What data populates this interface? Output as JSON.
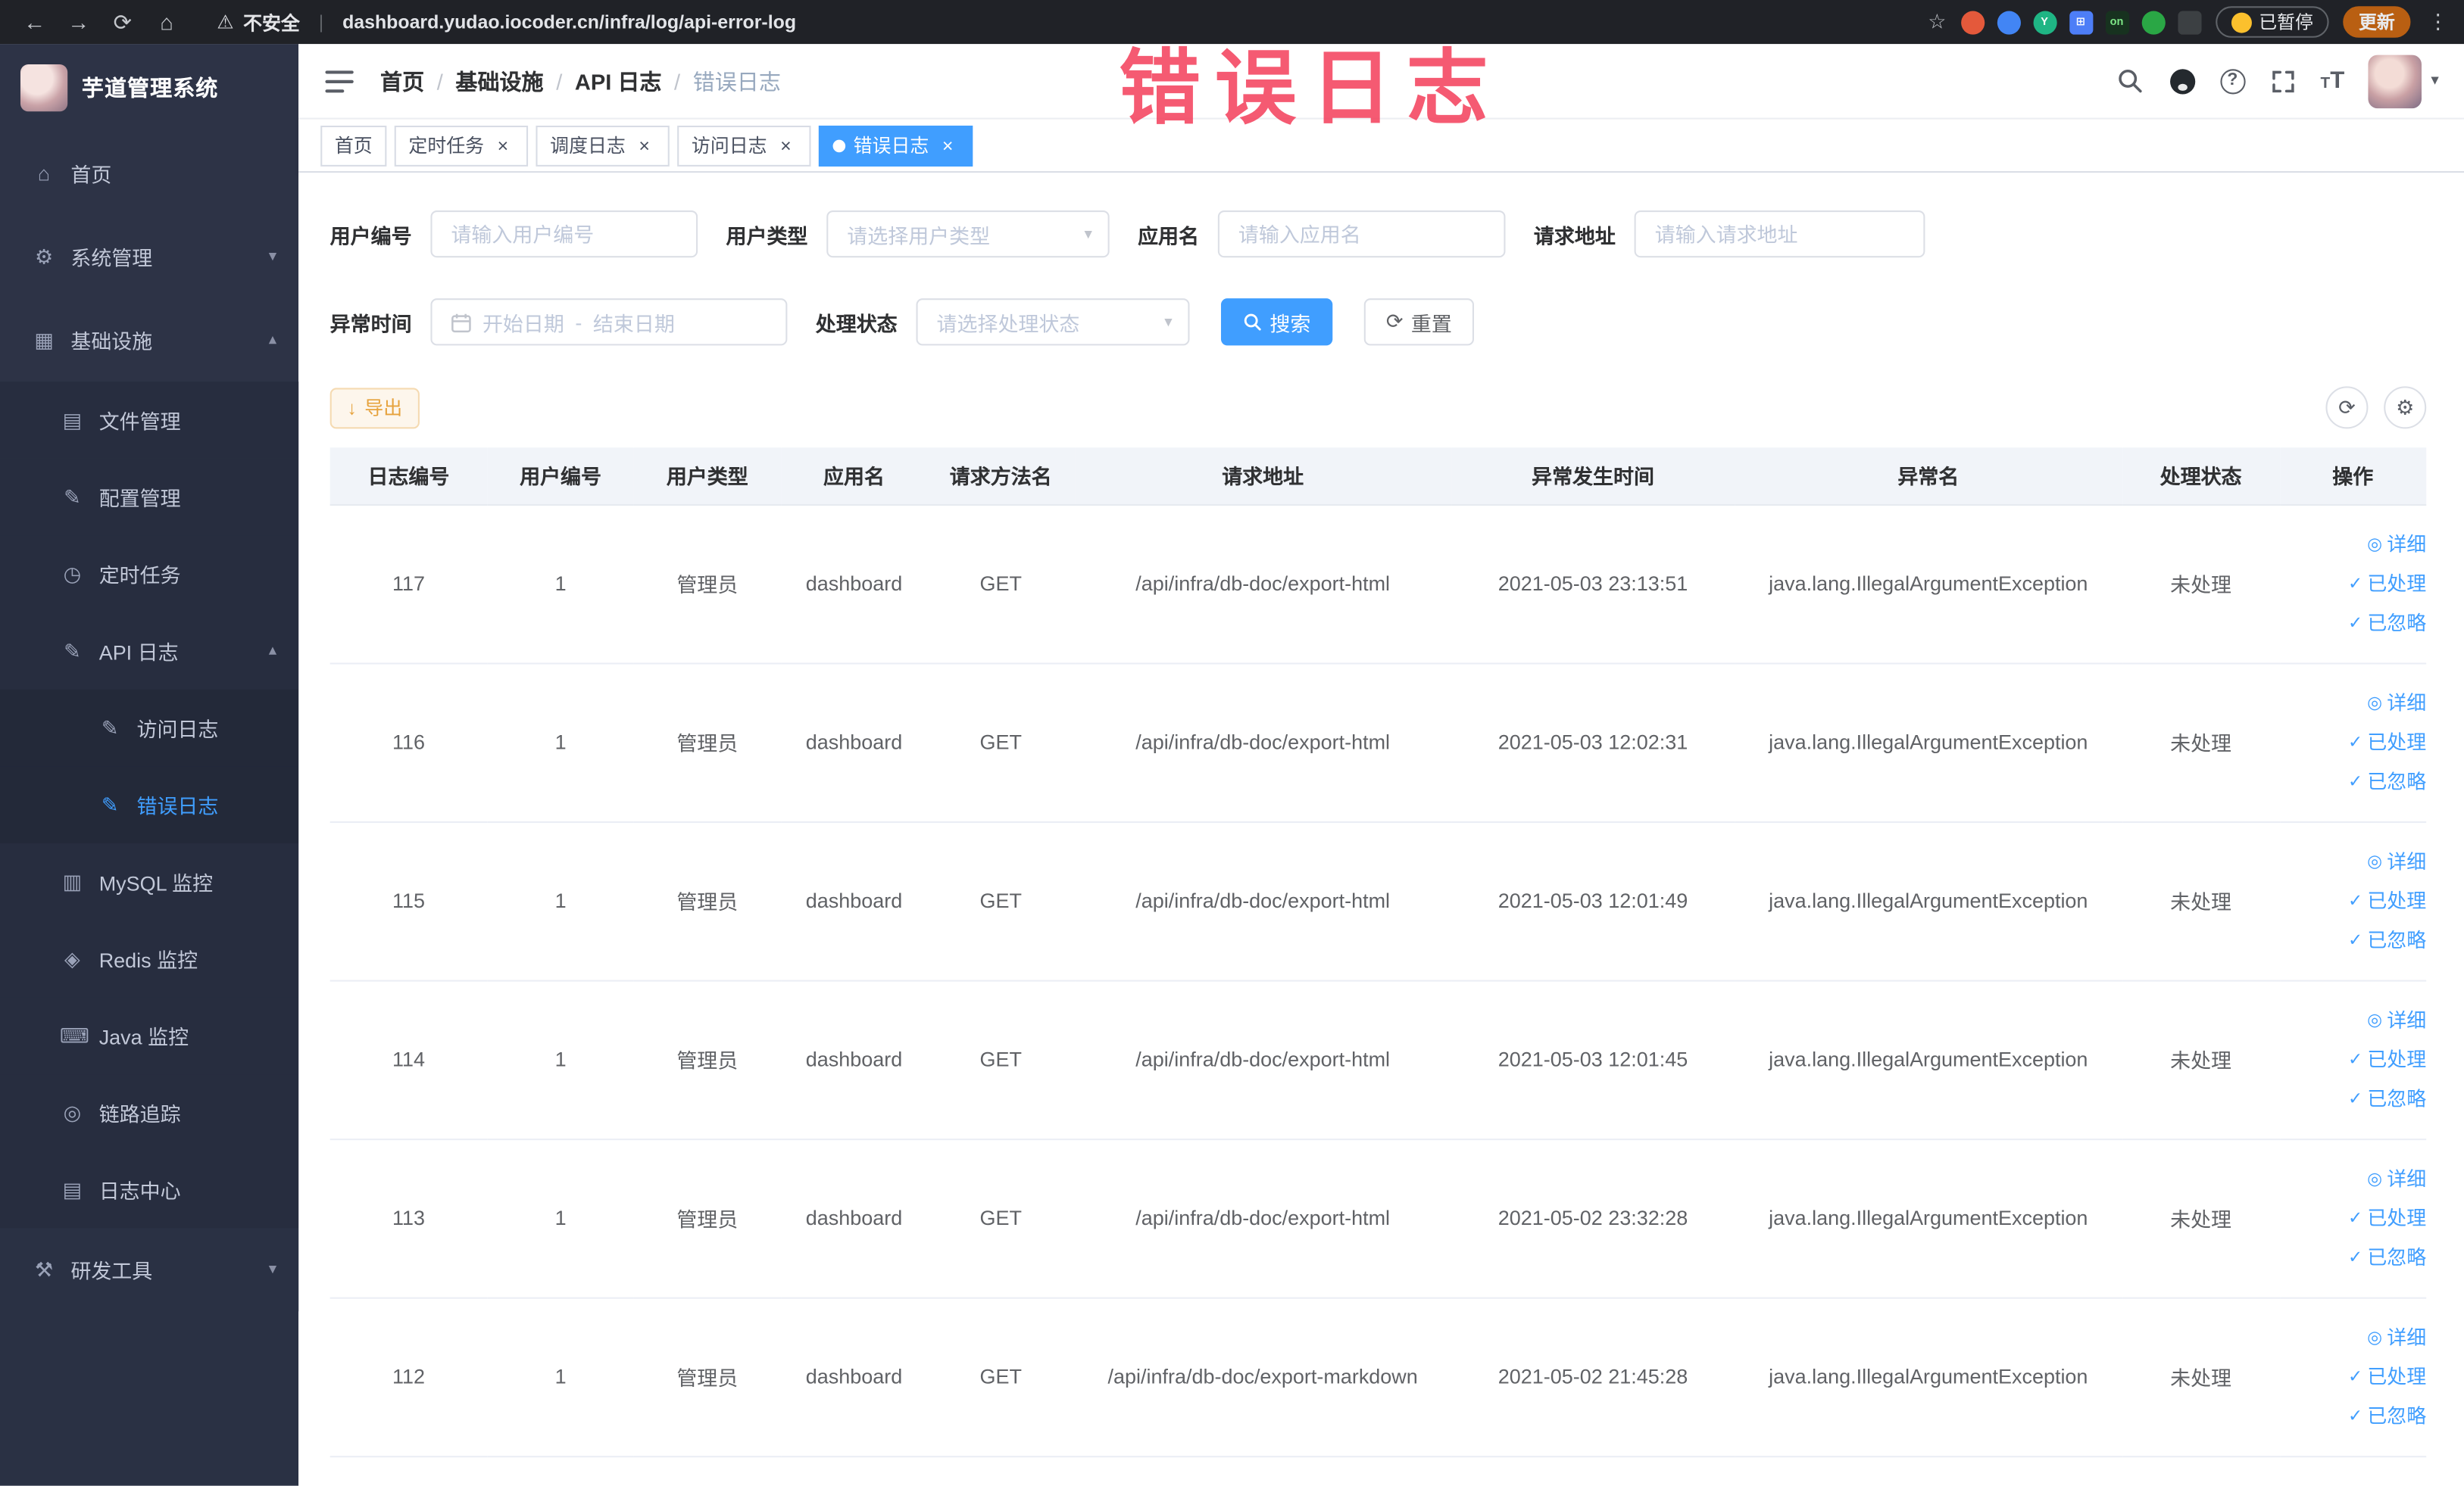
{
  "annotation": {
    "text": "错误日志",
    "color": "#f43e5a"
  },
  "browser": {
    "security_label": "不安全",
    "url": "dashboard.yudao.iocoder.cn/infra/log/api-error-log",
    "paused_label": "已暂停",
    "update_label": "更新",
    "extensions": [
      {
        "name": "extension-icon-1",
        "color": "#e4593b",
        "glyph": "",
        "shape": "circle"
      },
      {
        "name": "extension-icon-2",
        "color": "#4285f4",
        "glyph": "",
        "shape": "circle"
      },
      {
        "name": "extension-icon-3",
        "color": "#1fb584",
        "glyph": "Y",
        "shape": "circle"
      },
      {
        "name": "extension-icon-4",
        "color": "#4d7ef7",
        "glyph": "⊞",
        "shape": "square"
      },
      {
        "name": "extension-icon-5",
        "color": "#17321f",
        "glyph": "on",
        "shape": "square"
      },
      {
        "name": "extension-icon-6",
        "color": "#2aa745",
        "glyph": "",
        "shape": "circle"
      },
      {
        "name": "extension-icon-7",
        "color": "#3c4043",
        "glyph": "",
        "shape": "square"
      }
    ]
  },
  "sidebar": {
    "logo_title": "芋道管理系统",
    "items": [
      {
        "label": "首页",
        "icon": "home-icon",
        "level": 1
      },
      {
        "label": "系统管理",
        "icon": "gear-icon",
        "level": 1,
        "chevron": "down"
      },
      {
        "label": "基础设施",
        "icon": "grid-icon",
        "level": 1,
        "chevron": "up"
      },
      {
        "label": "文件管理",
        "icon": "folder-icon",
        "level": 2
      },
      {
        "label": "配置管理",
        "icon": "edit-icon",
        "level": 2
      },
      {
        "label": "定时任务",
        "icon": "timer-icon",
        "level": 2
      },
      {
        "label": "API 日志",
        "icon": "log-icon",
        "level": 2,
        "chevron": "up"
      },
      {
        "label": "访问日志",
        "icon": "doc-icon",
        "level": 3
      },
      {
        "label": "错误日志",
        "icon": "doc-icon",
        "level": 3,
        "active": true
      },
      {
        "label": "MySQL 监控",
        "icon": "database-icon",
        "level": 2
      },
      {
        "label": "Redis 监控",
        "icon": "redis-icon",
        "level": 2
      },
      {
        "label": "Java 监控",
        "icon": "java-icon",
        "level": 2
      },
      {
        "label": "链路追踪",
        "icon": "trace-icon",
        "level": 2
      },
      {
        "label": "日志中心",
        "icon": "logcenter-icon",
        "level": 2
      },
      {
        "label": "研发工具",
        "icon": "tools-icon",
        "level": 1,
        "chevron": "down",
        "last_root": true
      }
    ]
  },
  "header": {
    "breadcrumbs": [
      "首页",
      "基础设施",
      "API 日志",
      "错误日志"
    ]
  },
  "tabs": [
    {
      "label": "首页",
      "closable": false,
      "active": false
    },
    {
      "label": "定时任务",
      "closable": true,
      "active": false
    },
    {
      "label": "调度日志",
      "closable": true,
      "active": false
    },
    {
      "label": "访问日志",
      "closable": true,
      "active": false
    },
    {
      "label": "错误日志",
      "closable": true,
      "active": true
    }
  ],
  "filters": {
    "user_id": {
      "label": "用户编号",
      "placeholder": "请输入用户编号"
    },
    "user_type": {
      "label": "用户类型",
      "placeholder": "请选择用户类型"
    },
    "app_name": {
      "label": "应用名",
      "placeholder": "请输入应用名"
    },
    "request_url": {
      "label": "请求地址",
      "placeholder": "请输入请求地址"
    },
    "exception_time": {
      "label": "异常时间",
      "start_placeholder": "开始日期",
      "separator": "-",
      "end_placeholder": "结束日期"
    },
    "process_status": {
      "label": "处理状态",
      "placeholder": "请选择处理状态"
    },
    "search_label": "搜索",
    "reset_label": "重置"
  },
  "toolbar": {
    "export_label": "导出"
  },
  "table": {
    "columns": [
      {
        "key": "id",
        "label": "日志编号"
      },
      {
        "key": "user_id",
        "label": "用户编号"
      },
      {
        "key": "user_type",
        "label": "用户类型"
      },
      {
        "key": "app",
        "label": "应用名"
      },
      {
        "key": "method",
        "label": "请求方法名"
      },
      {
        "key": "url",
        "label": "请求地址"
      },
      {
        "key": "time",
        "label": "异常发生时间"
      },
      {
        "key": "exception",
        "label": "异常名"
      },
      {
        "key": "status",
        "label": "处理状态"
      },
      {
        "key": "actions",
        "label": "操作"
      }
    ],
    "rows": [
      {
        "id": "117",
        "user_id": "1",
        "user_type": "管理员",
        "app": "dashboard",
        "method": "GET",
        "url": "/api/infra/db-doc/export-html",
        "time": "2021-05-03 23:13:51",
        "exception": "java.lang.IllegalArgumentException",
        "status": "未处理"
      },
      {
        "id": "116",
        "user_id": "1",
        "user_type": "管理员",
        "app": "dashboard",
        "method": "GET",
        "url": "/api/infra/db-doc/export-html",
        "time": "2021-05-03 12:02:31",
        "exception": "java.lang.IllegalArgumentException",
        "status": "未处理"
      },
      {
        "id": "115",
        "user_id": "1",
        "user_type": "管理员",
        "app": "dashboard",
        "method": "GET",
        "url": "/api/infra/db-doc/export-html",
        "time": "2021-05-03 12:01:49",
        "exception": "java.lang.IllegalArgumentException",
        "status": "未处理"
      },
      {
        "id": "114",
        "user_id": "1",
        "user_type": "管理员",
        "app": "dashboard",
        "method": "GET",
        "url": "/api/infra/db-doc/export-html",
        "time": "2021-05-03 12:01:45",
        "exception": "java.lang.IllegalArgumentException",
        "status": "未处理"
      },
      {
        "id": "113",
        "user_id": "1",
        "user_type": "管理员",
        "app": "dashboard",
        "method": "GET",
        "url": "/api/infra/db-doc/export-html",
        "time": "2021-05-02 23:32:28",
        "exception": "java.lang.IllegalArgumentException",
        "status": "未处理"
      },
      {
        "id": "112",
        "user_id": "1",
        "user_type": "管理员",
        "app": "dashboard",
        "method": "GET",
        "url": "/api/infra/db-doc/export-markdown",
        "time": "2021-05-02 21:45:28",
        "exception": "java.lang.IllegalArgumentException",
        "status": "未处理"
      }
    ],
    "row_actions": [
      {
        "name": "detail",
        "label": "详细",
        "icon": "eye-icon"
      },
      {
        "name": "processed",
        "label": "已处理",
        "icon": "check-icon"
      },
      {
        "name": "ignored",
        "label": "已忽略",
        "icon": "check-icon"
      }
    ]
  }
}
